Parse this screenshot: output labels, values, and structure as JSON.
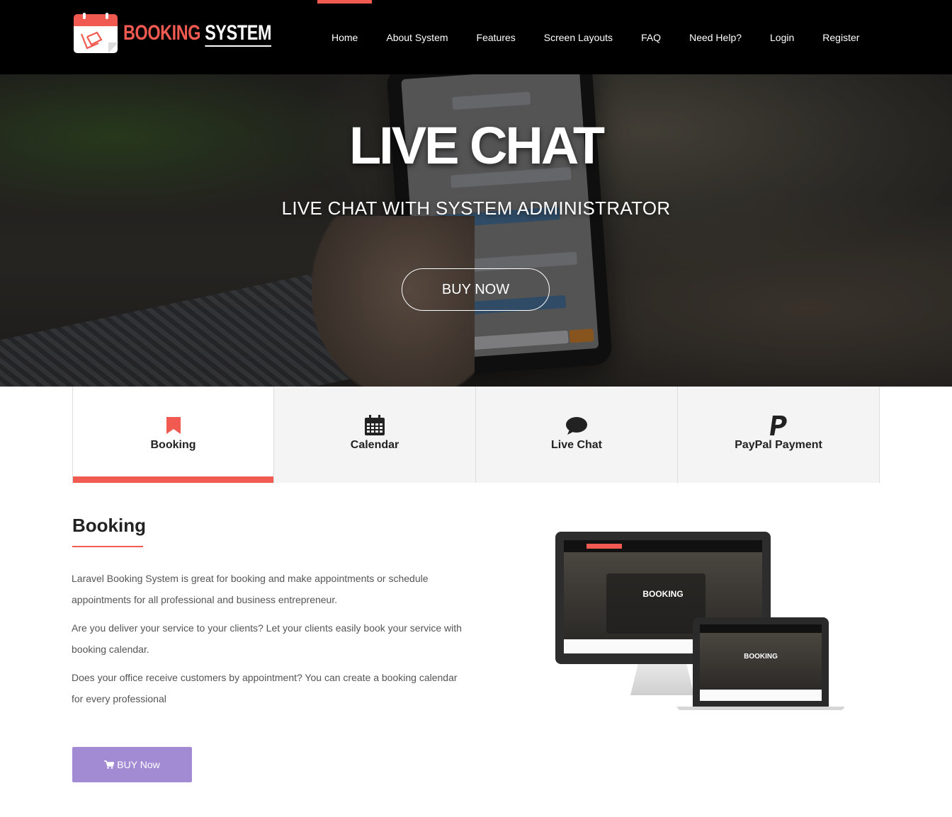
{
  "header": {
    "logo": {
      "word1": "BOOKING",
      "word2": "SYSTEM"
    },
    "nav": [
      {
        "label": "Home",
        "active": true
      },
      {
        "label": "About System"
      },
      {
        "label": "Features"
      },
      {
        "label": "Screen Layouts"
      },
      {
        "label": "FAQ"
      },
      {
        "label": "Need Help?"
      },
      {
        "label": "Login"
      },
      {
        "label": "Register"
      }
    ]
  },
  "hero": {
    "title": "LIVE CHAT",
    "subtitle": "LIVE CHAT WITH SYSTEM ADMINISTRATOR",
    "button": "BUY NOW"
  },
  "tabs": [
    {
      "label": "Booking",
      "icon": "bookmark-icon",
      "active": true
    },
    {
      "label": "Calendar",
      "icon": "calendar-icon"
    },
    {
      "label": "Live Chat",
      "icon": "chat-bubble-icon"
    },
    {
      "label": "PayPal Payment",
      "icon": "paypal-icon"
    }
  ],
  "content": {
    "title": "Booking",
    "paragraphs": [
      "Laravel Booking System is great for booking and make appointments or schedule appointments for all professional and business entrepreneur.",
      "Are you deliver your service to your clients? Let your clients easily book your service with booking calendar.",
      "Does your office receive customers by appointment? You can create a booking calendar for every professional"
    ],
    "buy_button": "BUY Now"
  },
  "colors": {
    "accent": "#f05a50",
    "buy_button": "#a38bd4",
    "header_bg": "#000000"
  }
}
